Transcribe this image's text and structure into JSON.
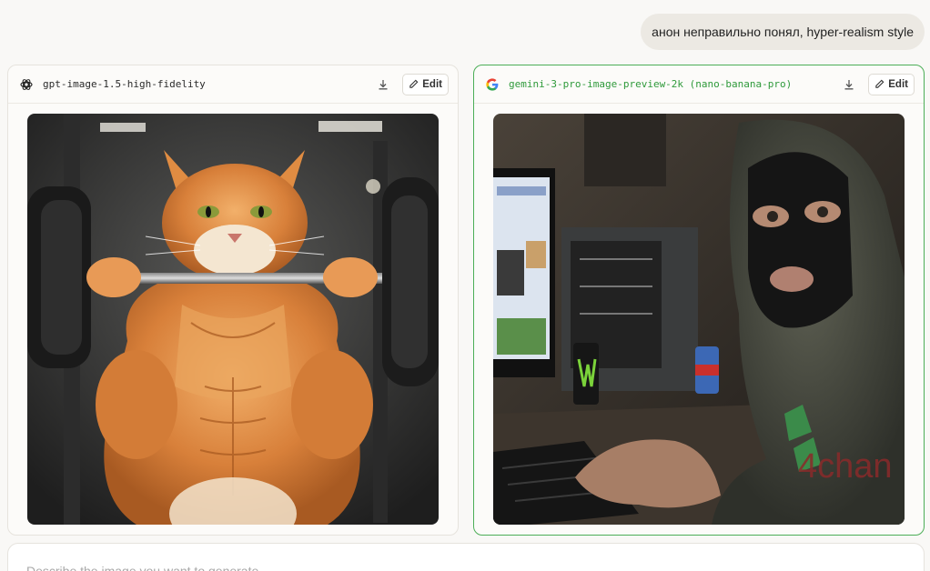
{
  "conversation": {
    "user_message": "анон неправильно понял, hyper-realism style"
  },
  "panels": [
    {
      "model": "gpt-image-1.5-high-fidelity",
      "provider_icon": "openai-logo-icon",
      "edit_label": "Edit",
      "image": "muscular orange cat lifting barbell in gym"
    },
    {
      "model": "gemini-3-pro-image-preview-2k (nano-banana-pro)",
      "provider_icon": "google-logo-icon",
      "edit_label": "Edit",
      "image": "person in balaclava and 4chan hoodie at computer desk"
    }
  ],
  "composer": {
    "placeholder": "Describe the image you want to generate"
  },
  "colors": {
    "accent_green": "#4cae57",
    "background": "#f9f8f6"
  }
}
